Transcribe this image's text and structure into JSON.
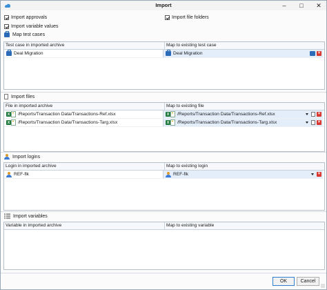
{
  "window": {
    "title": "Import"
  },
  "options": {
    "import_approvals": "Import approvals",
    "import_file_folders": "Import file folders",
    "import_variable_values": "Import variable values"
  },
  "test_cases": {
    "label": "Map test cases",
    "col1": "Test case in imported archive",
    "col2": "Map to existing test case",
    "rows": [
      {
        "imported": "Deal Migration",
        "mapped": "Deal Migration"
      }
    ]
  },
  "files": {
    "label": "Import files",
    "col1": "File in imported archive",
    "col2": "Map to existing file",
    "rows": [
      {
        "imported": "/Reports/Transaction Data/Transactions-Ref.xlsx",
        "mapped": "/Reports/Transaction Data/Transactions-Ref.xlsx"
      },
      {
        "imported": "/Reports/Transaction Data/Transactions-Targ.xlsx",
        "mapped": "/Reports/Transaction Data/Transactions-Targ.xlsx"
      }
    ]
  },
  "logins": {
    "label": "Import logins",
    "col1": "Login in imported archive",
    "col2": "Map to existing login",
    "rows": [
      {
        "imported": "REF-flk",
        "mapped": "REF-flk"
      }
    ]
  },
  "variables": {
    "label": "Import variables",
    "col1": "Variable in imported archive",
    "col2": "Map to existing variable",
    "rows": []
  },
  "buttons": {
    "ok": "OK",
    "cancel": "Cancel"
  },
  "icons": [
    "app-icon",
    "minimize-icon",
    "maximize-icon",
    "close-icon",
    "test-case-icon",
    "file-icon",
    "excel-icon",
    "login-icon",
    "variables-icon",
    "dropdown-icon",
    "delete-icon",
    "copy-icon"
  ],
  "colors": {
    "accent": "#2f7dd1",
    "selection": "#e4eefb",
    "delete": "#d8382f",
    "excel": "#1f7a3c"
  }
}
